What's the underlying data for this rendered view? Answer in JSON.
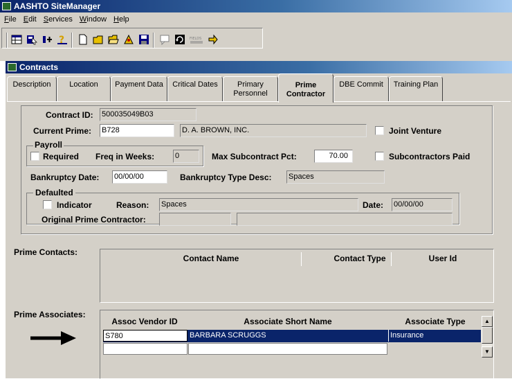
{
  "app": {
    "title": "AASHTO SiteManager"
  },
  "menu": [
    "File",
    "Edit",
    "Services",
    "Window",
    "Help"
  ],
  "toolbar": {
    "icons": [
      "grid-icon",
      "select-icon",
      "filter-icon",
      "help-icon",
      "new-icon",
      "open-icon",
      "open-folder-icon",
      "wizard-icon",
      "save-icon",
      "comment-icon",
      "refresh-icon",
      "fields-icon",
      "pointer-icon"
    ],
    "fields_label": "FIELDS"
  },
  "window": {
    "title": "Contracts"
  },
  "tabs": [
    {
      "label": "Description"
    },
    {
      "label": "Location"
    },
    {
      "label": "Payment Data"
    },
    {
      "label": "Critical Dates"
    },
    {
      "label": "Primary Personnel"
    },
    {
      "label": "Prime Contractor"
    },
    {
      "label": "DBE Commit"
    },
    {
      "label": "Training Plan"
    }
  ],
  "form": {
    "contract_id_label": "Contract ID:",
    "contract_id": "500035049B03",
    "current_prime_label": "Current Prime:",
    "current_prime_code": "B728",
    "current_prime_name": "D. A. BROWN, INC.",
    "joint_venture_label": "Joint Venture",
    "payroll_label": "Payroll",
    "required_label": "Required",
    "freq_label": "Freq in Weeks:",
    "freq_value": "0",
    "max_sub_label": "Max Subcontract Pct:",
    "max_sub_value": "70.00",
    "subs_paid_label": "Subcontractors Paid",
    "bankruptcy_date_label": "Bankruptcy Date:",
    "bankruptcy_date": "00/00/00",
    "bankruptcy_type_label": "Bankruptcy Type Desc:",
    "bankruptcy_type": "Spaces",
    "defaulted_label": "Defaulted",
    "indicator_label": "Indicator",
    "reason_label": "Reason:",
    "reason_value": "Spaces",
    "date_label": "Date:",
    "date_value": "00/00/00",
    "orig_prime_label": "Original Prime Contractor:",
    "orig_prime_code": "",
    "orig_prime_name": ""
  },
  "contacts": {
    "section_label": "Prime Contacts:",
    "columns": [
      "Contact Name",
      "Contact Type",
      "User Id"
    ],
    "rows": []
  },
  "associates": {
    "section_label": "Prime Associates:",
    "columns": [
      "Assoc Vendor ID",
      "Associate Short Name",
      "Associate Type"
    ],
    "rows": [
      {
        "vendor_id": "S780",
        "short_name": "BARBARA SCRUGGS",
        "type": "Insurance"
      },
      {
        "vendor_id": "",
        "short_name": "",
        "type": ""
      }
    ]
  },
  "colors": {
    "selected_row": "#0a246a",
    "chrome": "#d4d0c8",
    "title_blue": "#0a246a"
  }
}
